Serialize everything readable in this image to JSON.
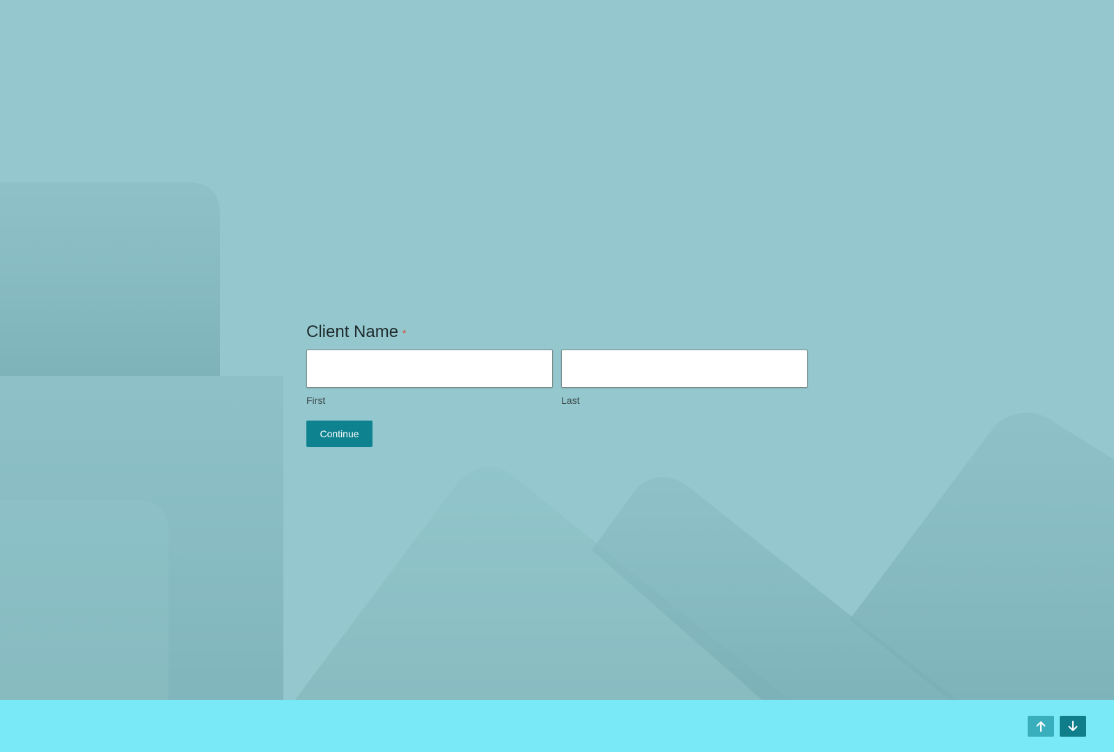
{
  "form": {
    "question_title": "Client Name",
    "required_mark": "*",
    "first_name": {
      "value": "",
      "placeholder": "",
      "sub_label": "First"
    },
    "last_name": {
      "value": "",
      "placeholder": "",
      "sub_label": "Last"
    },
    "continue_label": "Continue"
  },
  "footer": {
    "previous_icon": "arrow-up-icon",
    "next_icon": "arrow-down-icon"
  },
  "colors": {
    "background": "#94c8ce",
    "accent": "#0f8290",
    "footer_background": "#79e8f7",
    "required": "#d9452b"
  }
}
